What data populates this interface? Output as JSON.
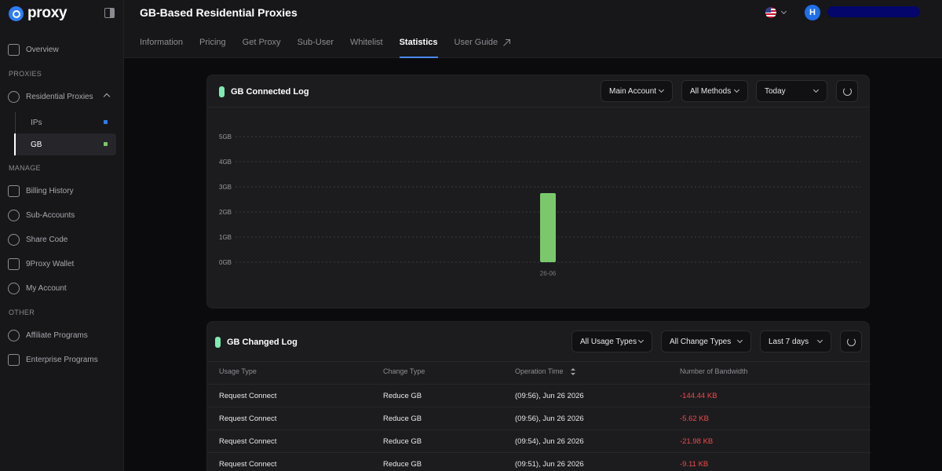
{
  "brand": {
    "name": "proxy"
  },
  "sidebar": {
    "overview": "Overview",
    "sections": {
      "proxies": "PROXIES",
      "manage": "MANAGE",
      "other": "OTHER"
    },
    "residential": "Residential Proxies",
    "sub_items": [
      {
        "label": "IPs",
        "dot_color": "#2f7cf6"
      },
      {
        "label": "GB",
        "dot_color": "#7bc86c"
      }
    ],
    "manage_items": [
      "Billing History",
      "Sub-Accounts",
      "Share Code",
      "9Proxy Wallet",
      "My Account"
    ],
    "other_items": [
      "Affiliate Programs",
      "Enterprise Programs"
    ]
  },
  "header": {
    "title": "GB-Based Residential Proxies",
    "avatar_initial": "H",
    "tabs": [
      "Information",
      "Pricing",
      "Get Proxy",
      "Sub-User",
      "Whitelist",
      "Statistics",
      "User Guide"
    ],
    "active_tab": "Statistics"
  },
  "connected_log": {
    "title": "GB Connected Log",
    "filters": {
      "account": "Main Account",
      "method": "All Methods",
      "range": "Today"
    }
  },
  "chart_data": {
    "type": "bar",
    "categories": [
      "26-06"
    ],
    "values": [
      2.75
    ],
    "y_ticks": [
      "0GB",
      "1GB",
      "2GB",
      "3GB",
      "4GB",
      "5GB"
    ],
    "ylim": [
      0,
      5
    ],
    "grid": true,
    "bar_color": "#7bc86c"
  },
  "changed_log": {
    "title": "GB Changed Log",
    "filters": {
      "usage": "All Usage Types",
      "change": "All Change Types",
      "range": "Last 7 days"
    },
    "columns": [
      "Usage Type",
      "Change Type",
      "Operation Time",
      "Number of Bandwidth"
    ],
    "rows": [
      {
        "usage": "Request Connect",
        "change": "Reduce GB",
        "time": "(09:56), Jun 26 2026",
        "bandwidth": "-144.44 KB"
      },
      {
        "usage": "Request Connect",
        "change": "Reduce GB",
        "time": "(09:56), Jun 26 2026",
        "bandwidth": "-5.62 KB"
      },
      {
        "usage": "Request Connect",
        "change": "Reduce GB",
        "time": "(09:54), Jun 26 2026",
        "bandwidth": "-21.98 KB"
      },
      {
        "usage": "Request Connect",
        "change": "Reduce GB",
        "time": "(09:51), Jun 26 2026",
        "bandwidth": "-9.11 KB"
      }
    ]
  }
}
